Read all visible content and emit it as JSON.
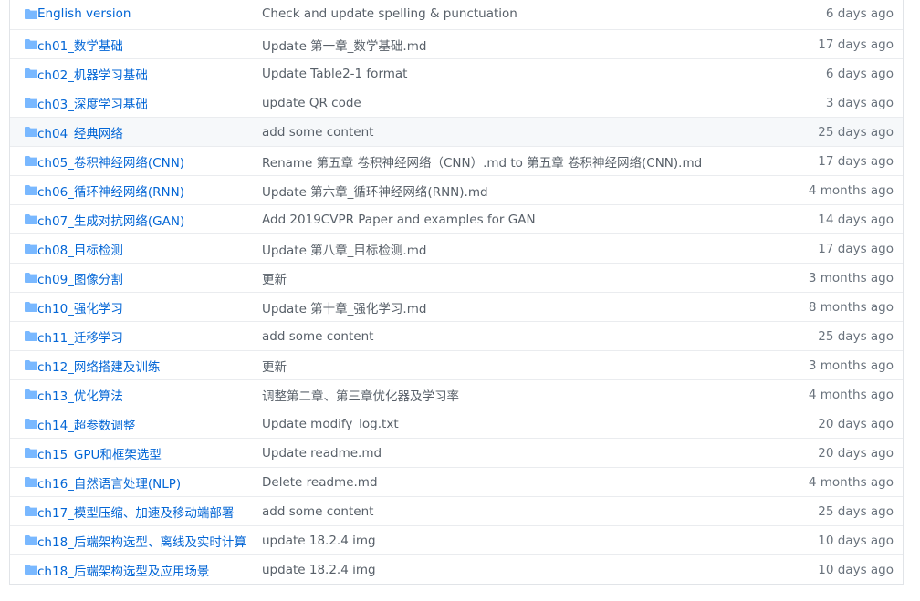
{
  "colors": {
    "link": "#0366d6",
    "folder_icon": "#79b8ff",
    "muted_text": "#586069",
    "border": "#eaecef",
    "hover_row": "#f6f8fa"
  },
  "files": [
    {
      "icon": "folder-icon",
      "name": "English version",
      "message": "Check and update spelling & punctuation",
      "age": "6 days ago"
    },
    {
      "icon": "folder-icon",
      "name": "ch01_数学基础",
      "message": "Update 第一章_数学基础.md",
      "age": "17 days ago"
    },
    {
      "icon": "folder-icon",
      "name": "ch02_机器学习基础",
      "message": "Update Table2-1 format",
      "age": "6 days ago"
    },
    {
      "icon": "folder-icon",
      "name": "ch03_深度学习基础",
      "message": "update QR code",
      "age": "3 days ago"
    },
    {
      "icon": "folder-icon",
      "name": "ch04_经典网络",
      "message": "add some content",
      "age": "25 days ago"
    },
    {
      "icon": "folder-icon",
      "name": "ch05_卷积神经网络(CNN)",
      "message": "Rename 第五章 卷积神经网络（CNN）.md to 第五章 卷积神经网络(CNN).md",
      "age": "17 days ago"
    },
    {
      "icon": "folder-icon",
      "name": "ch06_循环神经网络(RNN)",
      "message": "Update 第六章_循环神经网络(RNN).md",
      "age": "4 months ago"
    },
    {
      "icon": "folder-icon",
      "name": "ch07_生成对抗网络(GAN)",
      "message": "Add 2019CVPR Paper and examples for GAN",
      "age": "14 days ago"
    },
    {
      "icon": "folder-icon",
      "name": "ch08_目标检测",
      "message": "Update 第八章_目标检测.md",
      "age": "17 days ago"
    },
    {
      "icon": "folder-icon",
      "name": "ch09_图像分割",
      "message": "更新",
      "age": "3 months ago"
    },
    {
      "icon": "folder-icon",
      "name": "ch10_强化学习",
      "message": "Update 第十章_强化学习.md",
      "age": "8 months ago"
    },
    {
      "icon": "folder-icon",
      "name": "ch11_迁移学习",
      "message": "add some content",
      "age": "25 days ago"
    },
    {
      "icon": "folder-icon",
      "name": "ch12_网络搭建及训练",
      "message": "更新",
      "age": "3 months ago"
    },
    {
      "icon": "folder-icon",
      "name": "ch13_优化算法",
      "message": "调整第二章、第三章优化器及学习率",
      "age": "4 months ago"
    },
    {
      "icon": "folder-icon",
      "name": "ch14_超参数调整",
      "message": "Update modify_log.txt",
      "age": "20 days ago"
    },
    {
      "icon": "folder-icon",
      "name": "ch15_GPU和框架选型",
      "message": "Update readme.md",
      "age": "20 days ago"
    },
    {
      "icon": "folder-icon",
      "name": "ch16_自然语言处理(NLP)",
      "message": "Delete readme.md",
      "age": "4 months ago"
    },
    {
      "icon": "folder-icon",
      "name": "ch17_模型压缩、加速及移动端部署",
      "message": "add some content",
      "age": "25 days ago"
    },
    {
      "icon": "folder-icon",
      "name": "ch18_后端架构选型、离线及实时计算",
      "message": "update 18.2.4 img",
      "age": "10 days ago"
    },
    {
      "icon": "folder-icon",
      "name": "ch18_后端架构选型及应用场景",
      "message": "update 18.2.4 img",
      "age": "10 days ago"
    }
  ]
}
